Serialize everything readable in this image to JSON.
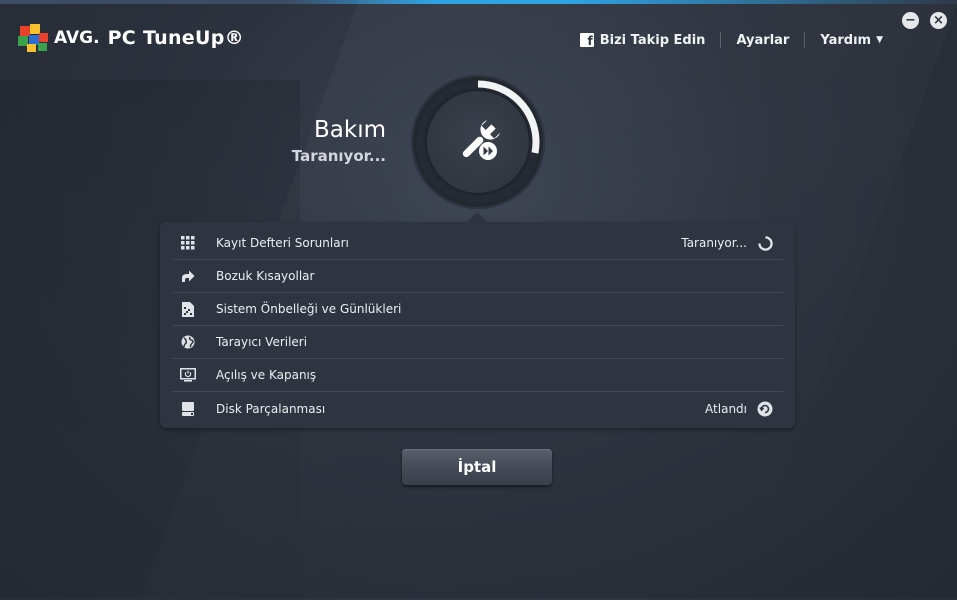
{
  "app": {
    "brand": "AVG.",
    "product": "PC TuneUp®"
  },
  "header": {
    "follow_label": "Bizi Takip Edin",
    "settings_label": "Ayarlar",
    "help_label": "Yardım"
  },
  "window": {
    "minimize_glyph": "−",
    "close_glyph": "×"
  },
  "scan": {
    "title": "Bakım",
    "status": "Taranıyor...",
    "progress": 0.28
  },
  "items": [
    {
      "label": "Kayıt Defteri Sorunları",
      "status": "Taranıyor...",
      "icon": "grid-icon",
      "status_icon": "spinner-icon"
    },
    {
      "label": "Bozuk Kısayollar",
      "status": "",
      "icon": "shortcut-arrow-icon",
      "status_icon": ""
    },
    {
      "label": "Sistem Önbelleği ve Günlükleri",
      "status": "",
      "icon": "cache-file-icon",
      "status_icon": ""
    },
    {
      "label": "Tarayıcı Verileri",
      "status": "",
      "icon": "globe-icon",
      "status_icon": ""
    },
    {
      "label": "Açılış ve Kapanış",
      "status": "",
      "icon": "monitor-power-icon",
      "status_icon": ""
    },
    {
      "label": "Disk Parçalanması",
      "status": "Atlandı",
      "icon": "disk-icon",
      "status_icon": "skip-icon"
    }
  ],
  "actions": {
    "cancel_label": "İptal"
  },
  "colors": {
    "accent": "#2a9fe0",
    "background": "#2c323d",
    "panel": "#2f3540"
  }
}
